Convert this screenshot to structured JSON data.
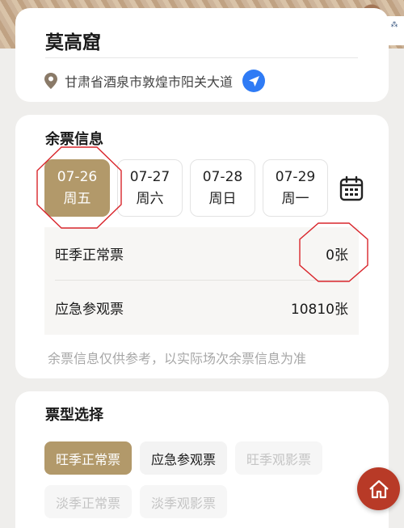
{
  "site": {
    "name": "莫高窟",
    "address": "甘肃省酒泉市敦煌市阳关大道",
    "pin_icon": "location-pin-icon",
    "nav_icon": "navigation-arrow-icon"
  },
  "tickets": {
    "section_title": "余票信息",
    "dates": [
      {
        "date": "07-26",
        "weekday": "周五",
        "selected": true
      },
      {
        "date": "07-27",
        "weekday": "周六",
        "selected": false
      },
      {
        "date": "07-28",
        "weekday": "周日",
        "selected": false
      },
      {
        "date": "07-29",
        "weekday": "周一",
        "selected": false
      }
    ],
    "calendar_icon": "calendar-icon",
    "stock": [
      {
        "label": "旺季正常票",
        "count": "0张"
      },
      {
        "label": "应急参观票",
        "count": "10810张"
      }
    ],
    "note": "余票信息仅供参考，以实际场次余票信息为准"
  },
  "ticket_types": {
    "section_title": "票型选择",
    "options": [
      {
        "label": "旺季正常票",
        "state": "selected"
      },
      {
        "label": "应急参观票",
        "state": "available"
      },
      {
        "label": "旺季观影票",
        "state": "disabled"
      },
      {
        "label": "淡季正常票",
        "state": "disabled"
      },
      {
        "label": "淡季观影票",
        "state": "disabled"
      }
    ]
  },
  "home_button": {
    "icon": "home-icon"
  },
  "colors": {
    "accent": "#b2996a",
    "nav_blue": "#2f7bf5",
    "home_red": "#b83a27",
    "annotation_red": "#d9262c"
  }
}
